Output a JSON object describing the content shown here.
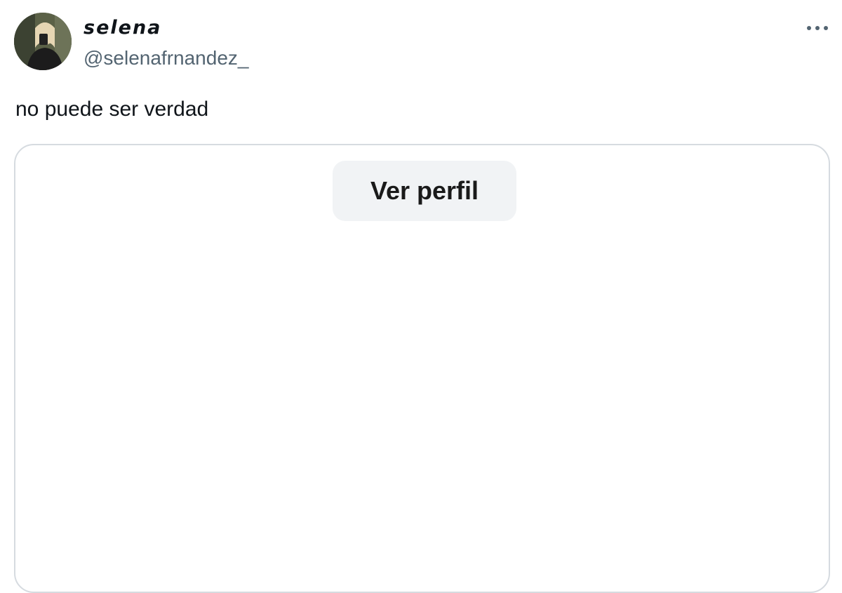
{
  "post": {
    "author": {
      "display_name": "selena",
      "handle": "@selenafrnandez_",
      "avatar_icon": "profile-photo"
    },
    "menu_icon": "more-options-icon",
    "text": "no puede ser verdad",
    "embed": {
      "button_label": "Ver perfil"
    }
  },
  "colors": {
    "text": "#0f1419",
    "secondary_text": "#536471",
    "card_border": "#d6dbe0",
    "button_bg": "#f1f3f5"
  }
}
